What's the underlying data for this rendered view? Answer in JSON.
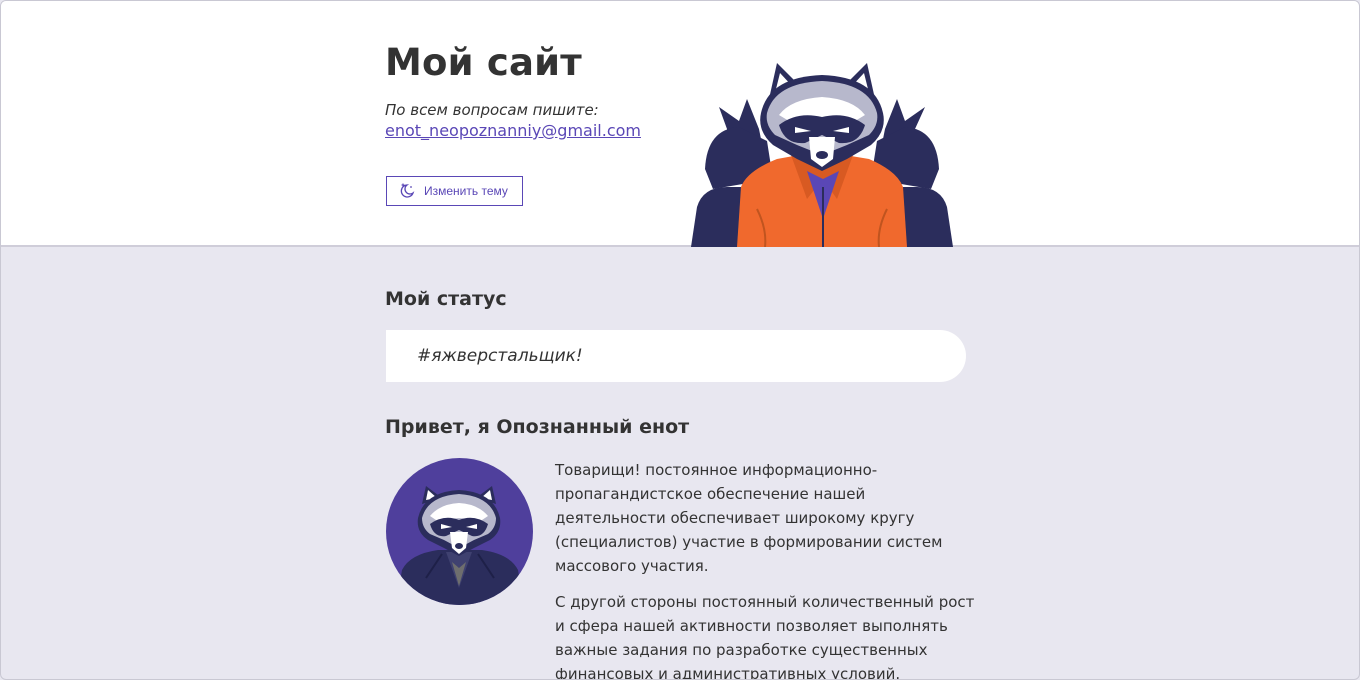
{
  "header": {
    "title": "Мой сайт",
    "contact_label": "По всем вопросам пишите:",
    "email": "enot_neopoznanniy@gmail.com",
    "theme_button_label": "Изменить тему",
    "theme_icon": "moon-stars-icon"
  },
  "status": {
    "title": "Мой статус",
    "text": "#яжверстальщик!"
  },
  "about": {
    "title": "Привет, я Опознанный енот",
    "paragraphs": [
      "Товарищи! постоянное информационно-пропагандистское обеспечение нашей деятельности обеспечивает широкому кругу (специалистов) участие в формировании систем массового участия.",
      "С другой стороны постоянный количественный рост и сфера нашей активности позволяет выполнять важные задания по разработке существенных финансовых и административных условий."
    ]
  },
  "colors": {
    "accent": "#5a47b6",
    "page_background": "#e8e7f0",
    "header_background": "#ffffff",
    "jacket_orange": "#f0692d",
    "navy": "#2b2d5c"
  }
}
